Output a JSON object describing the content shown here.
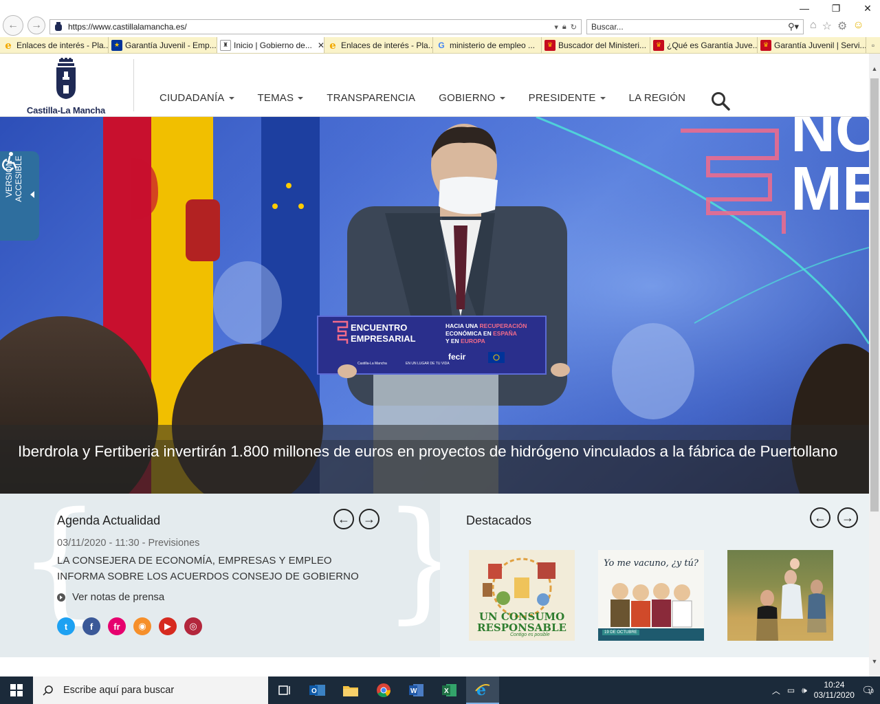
{
  "browser": {
    "url": "https://www.castillalamancha.es/",
    "search_placeholder": "Buscar...",
    "tabs": [
      {
        "label": "Enlaces de interés - Pla...",
        "icon": "ie-icon"
      },
      {
        "label": "Garantía Juvenil - Emp...",
        "icon": "eu-flag-icon"
      },
      {
        "label": "Inicio | Gobierno de...",
        "icon": "clm-icon",
        "active": true,
        "close": "✕"
      },
      {
        "label": "Enlaces de interés - Pla...",
        "icon": "ie-icon"
      },
      {
        "label": "ministerio de empleo ...",
        "icon": "google-icon"
      },
      {
        "label": "Buscador del Ministeri...",
        "icon": "spain-crest-icon"
      },
      {
        "label": "¿Qué es Garantía Juve...",
        "icon": "spain-crest-icon"
      },
      {
        "label": "Garantía Juvenil | Servi...",
        "icon": "spain-crest-icon"
      }
    ]
  },
  "site": {
    "logo_text": "Castilla-La Mancha",
    "nav": [
      {
        "label": "CIUDADANÍA",
        "dropdown": true
      },
      {
        "label": "TEMAS",
        "dropdown": true
      },
      {
        "label": "TRANSPARENCIA",
        "dropdown": false
      },
      {
        "label": "GOBIERNO",
        "dropdown": true
      },
      {
        "label": "PRESIDENTE",
        "dropdown": true
      },
      {
        "label": "LA REGIÓN",
        "dropdown": false
      }
    ],
    "accessible_tab": {
      "line1": "VERSIÓN",
      "line2": "ACCESIBLE"
    }
  },
  "hero": {
    "caption": "Iberdrola y Fertiberia invertirán 1.800 millones de euros en proyectos de hidrógeno vinculados a la fábrica de Puertollano",
    "lectern": {
      "title1": "ENCUENTRO",
      "title2": "EMPRESARIAL",
      "tagline_1": "HACIA UNA",
      "tagline_2": "RECUPERACIÓN",
      "tagline_3": "ECONÓMICA EN",
      "tagline_4": "ESPAÑA",
      "tagline_5": "Y EN",
      "tagline_6": "EUROPA",
      "logo_1": "Castilla-La Mancha",
      "logo_2": "EN UN LUGAR DE TU VIDA",
      "logo_3": "fecir"
    },
    "backdrop_letters": "NC\nME"
  },
  "agenda": {
    "title": "Agenda Actualidad",
    "date": "03/11/2020 - 11:30",
    "separator": " - ",
    "category": "Previsiones",
    "headline": "LA CONSEJERA DE ECONOMÍA, EMPRESAS Y EMPLEO INFORMA SOBRE LOS ACUERDOS CONSEJO DE GOBIERNO",
    "press_link": "Ver notas de prensa",
    "prev": "←",
    "next": "→",
    "social": [
      {
        "name": "twitter-icon",
        "glyph": "t",
        "color": "#1da1f2"
      },
      {
        "name": "facebook-icon",
        "glyph": "f",
        "color": "#3b5998"
      },
      {
        "name": "flickr-icon",
        "glyph": "fr",
        "color": "#e6006e"
      },
      {
        "name": "rss-icon",
        "glyph": "◉",
        "color": "#f68f2a"
      },
      {
        "name": "youtube-icon",
        "glyph": "▶",
        "color": "#d62a1f"
      },
      {
        "name": "instagram-icon",
        "glyph": "◎",
        "color": "#b3263c"
      }
    ]
  },
  "destacados": {
    "title": "Destacados",
    "prev": "←",
    "next": "→",
    "items": [
      {
        "line1": "UN CONSUMO",
        "line2": "RESPONSABLE",
        "line3": "Contigo es posible"
      },
      {
        "line1": "Yo me vacuno, ¿y tú?",
        "badge": "19 DE OCTUBRE"
      },
      {
        "alt": "Familia en el campo"
      }
    ]
  },
  "taskbar": {
    "search_placeholder": "Escribe aquí para buscar",
    "time": "10:24",
    "date": "03/11/2020",
    "notifications": "10"
  }
}
